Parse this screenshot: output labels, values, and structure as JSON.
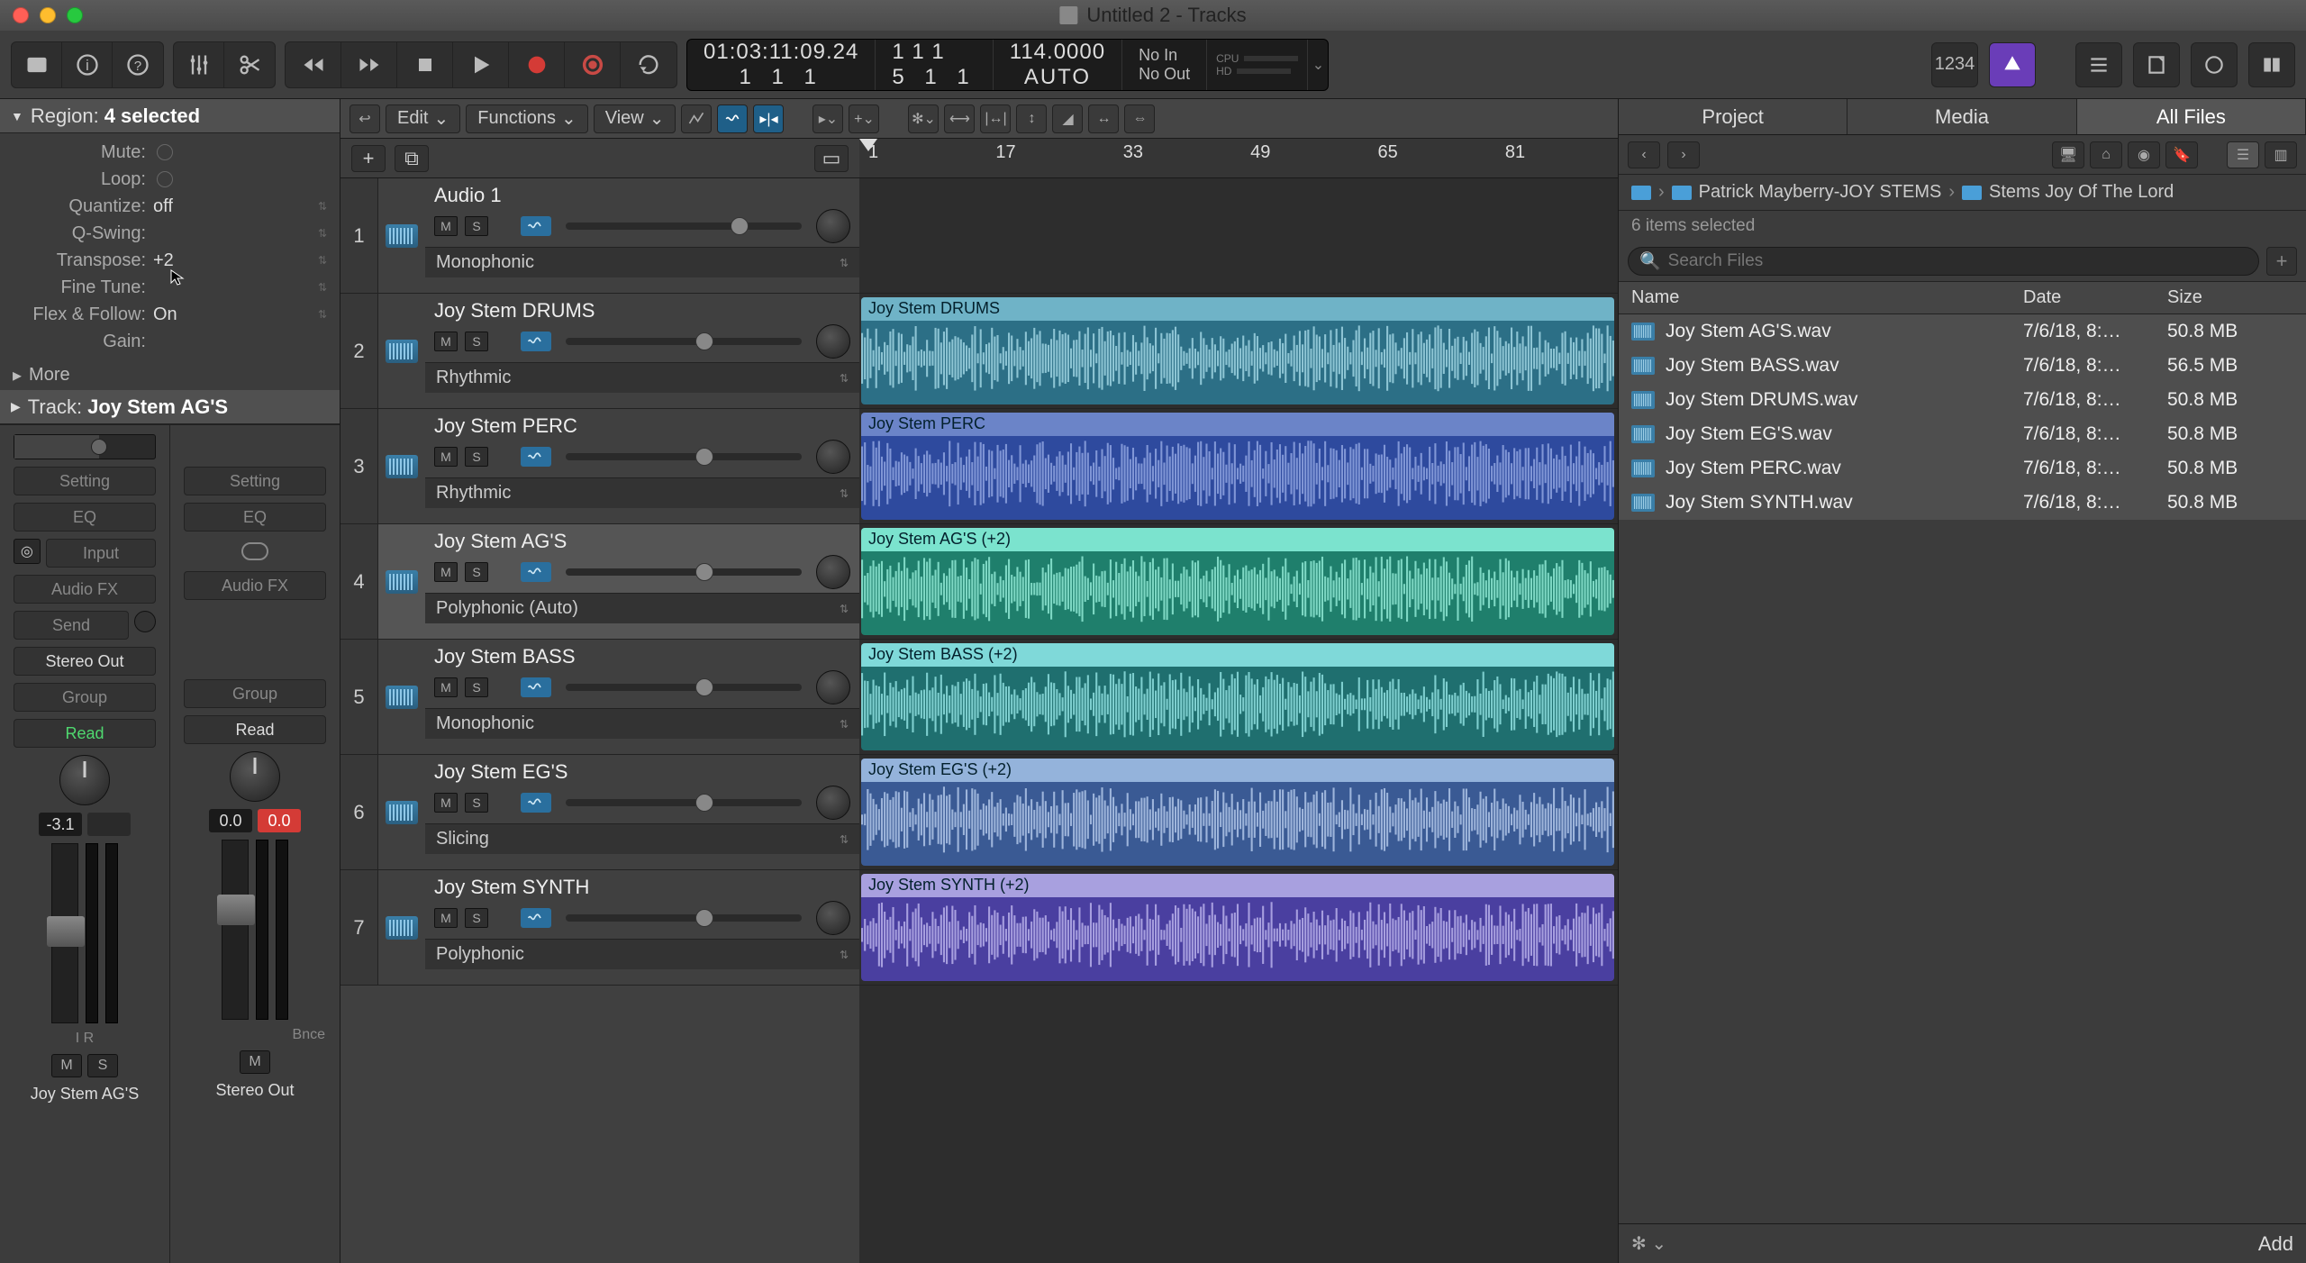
{
  "window": {
    "title": "Untitled 2 - Tracks"
  },
  "lcd": {
    "position": "01:03:11:09.24",
    "beats_top": "1   1   1",
    "beats_bot": "1   1   1",
    "bars_top": "1   1   1",
    "bars_bot": "5   1   1",
    "tempo": "114.0000",
    "tempo_mode": "AUTO",
    "sync_in": "No In",
    "sync_out": "No Out",
    "perf_cpu": "CPU",
    "perf_hd": "HD"
  },
  "counter_btn": "1234",
  "inspector": {
    "region_label": "Region:",
    "region_value": "4 selected",
    "params": [
      {
        "label": "Mute:",
        "value": "",
        "toggle": true
      },
      {
        "label": "Loop:",
        "value": "",
        "toggle": true
      },
      {
        "label": "Quantize:",
        "value": "off",
        "menu": true
      },
      {
        "label": "Q-Swing:",
        "value": "",
        "menu": true
      },
      {
        "label": "Transpose:",
        "value": "+2",
        "menu": true
      },
      {
        "label": "Fine Tune:",
        "value": "",
        "menu": true
      },
      {
        "label": "Flex & Follow:",
        "value": "On",
        "menu": true
      },
      {
        "label": "Gain:",
        "value": ""
      }
    ],
    "more": "More",
    "track_label": "Track:",
    "track_value": "Joy Stem AG'S"
  },
  "strip1": {
    "setting": "Setting",
    "eq": "EQ",
    "input": "Input",
    "audiofx": "Audio FX",
    "send": "Send",
    "out": "Stereo Out",
    "group": "Group",
    "auto": "Read",
    "pan": "-3.1",
    "ir": "I   R",
    "m": "M",
    "s": "S",
    "name": "Joy Stem AG'S"
  },
  "strip2": {
    "setting": "Setting",
    "eq": "EQ",
    "audiofx": "Audio FX",
    "group": "Group",
    "auto": "Read",
    "pan": "0.0",
    "pan2": "0.0",
    "bnce": "Bnce",
    "m": "M",
    "name": "Stereo Out"
  },
  "track_menu": {
    "edit": "Edit",
    "functions": "Functions",
    "view": "View"
  },
  "ruler": {
    "ticks": [
      "1",
      "17",
      "33",
      "49",
      "65",
      "81"
    ]
  },
  "tracks": [
    {
      "num": "1",
      "name": "Audio 1",
      "m": "M",
      "s": "S",
      "algo": "Monophonic",
      "vol": 0.7
    },
    {
      "num": "2",
      "name": "Joy Stem DRUMS",
      "m": "M",
      "s": "S",
      "algo": "Rhythmic",
      "vol": 0.55
    },
    {
      "num": "3",
      "name": "Joy Stem PERC",
      "m": "M",
      "s": "S",
      "algo": "Rhythmic",
      "vol": 0.55
    },
    {
      "num": "4",
      "name": "Joy Stem AG'S",
      "m": "M",
      "s": "S",
      "algo": "Polyphonic (Auto)",
      "vol": 0.55,
      "sel": true
    },
    {
      "num": "5",
      "name": "Joy Stem BASS",
      "m": "M",
      "s": "S",
      "algo": "Monophonic",
      "vol": 0.55
    },
    {
      "num": "6",
      "name": "Joy Stem EG'S",
      "m": "M",
      "s": "S",
      "algo": "Slicing",
      "vol": 0.55
    },
    {
      "num": "7",
      "name": "Joy Stem SYNTH",
      "m": "M",
      "s": "S",
      "algo": "Polyphonic",
      "vol": 0.55
    }
  ],
  "regions": [
    {
      "lane": 1,
      "label": "Joy Stem DRUMS",
      "cls": "r-drums"
    },
    {
      "lane": 2,
      "label": "Joy Stem PERC",
      "cls": "r-perc"
    },
    {
      "lane": 3,
      "label": "Joy Stem AG'S (+2)",
      "cls": "r-ags"
    },
    {
      "lane": 4,
      "label": "Joy Stem BASS (+2)",
      "cls": "r-bass"
    },
    {
      "lane": 5,
      "label": "Joy Stem EG'S (+2)",
      "cls": "r-egs"
    },
    {
      "lane": 6,
      "label": "Joy Stem SYNTH (+2)",
      "cls": "r-synth"
    }
  ],
  "browser": {
    "tabs": {
      "project": "Project",
      "media": "Media",
      "all": "All Files"
    },
    "crumbs": [
      "Patrick Mayberry-JOY STEMS",
      "Stems Joy Of The Lord"
    ],
    "selected_info": "6 items selected",
    "search_placeholder": "Search Files",
    "columns": {
      "name": "Name",
      "date": "Date",
      "size": "Size"
    },
    "files": [
      {
        "name": "Joy Stem AG'S.wav",
        "date": "7/6/18, 8:…",
        "size": "50.8 MB"
      },
      {
        "name": "Joy Stem BASS.wav",
        "date": "7/6/18, 8:…",
        "size": "56.5 MB"
      },
      {
        "name": "Joy Stem DRUMS.wav",
        "date": "7/6/18, 8:…",
        "size": "50.8 MB"
      },
      {
        "name": "Joy Stem EG'S.wav",
        "date": "7/6/18, 8:…",
        "size": "50.8 MB"
      },
      {
        "name": "Joy Stem PERC.wav",
        "date": "7/6/18, 8:…",
        "size": "50.8 MB"
      },
      {
        "name": "Joy Stem SYNTH.wav",
        "date": "7/6/18, 8:…",
        "size": "50.8 MB"
      }
    ],
    "add": "Add"
  }
}
